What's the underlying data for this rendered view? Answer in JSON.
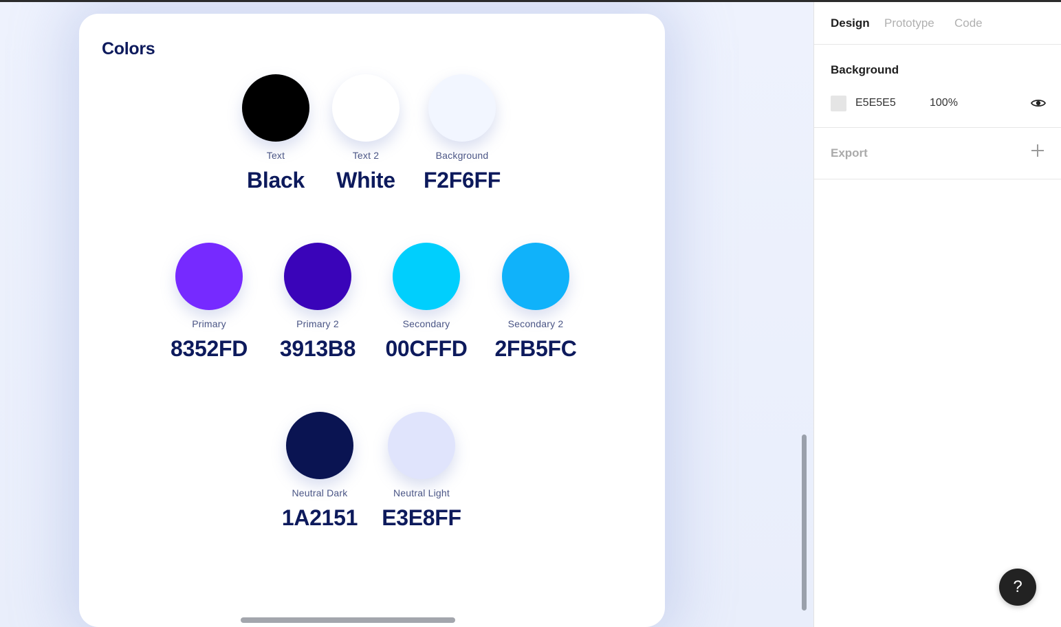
{
  "card": {
    "title": "Colors",
    "swatches": [
      {
        "name": "Text",
        "hex": "Black",
        "color": "#000000"
      },
      {
        "name": "Text 2",
        "hex": "White",
        "color": "#ffffff"
      },
      {
        "name": "Background",
        "hex": "F2F6FF",
        "color": "#F2F6FF"
      },
      {
        "name": "Primary",
        "hex": "8352FD",
        "color": "#762AFF"
      },
      {
        "name": "Primary 2",
        "hex": "3913B8",
        "color": "#3A04B9"
      },
      {
        "name": "Secondary",
        "hex": "00CFFD",
        "color": "#00CFFD"
      },
      {
        "name": "Secondary 2",
        "hex": "2FB5FC",
        "color": "#10B2FA"
      },
      {
        "name": "Neutral Dark",
        "hex": "1A2151",
        "color": "#0A1452"
      },
      {
        "name": "Neutral Light",
        "hex": "E3E8FF",
        "color": "#E0E4FC"
      }
    ]
  },
  "panel": {
    "tabs": [
      "Design",
      "Prototype",
      "Code"
    ],
    "active_tab": "Design",
    "background": {
      "title": "Background",
      "hex": "E5E5E5",
      "opacity": "100%",
      "visibility_icon": "eye-icon"
    },
    "export": {
      "title": "Export",
      "add_icon": "plus-icon"
    }
  },
  "help": {
    "label": "?"
  }
}
